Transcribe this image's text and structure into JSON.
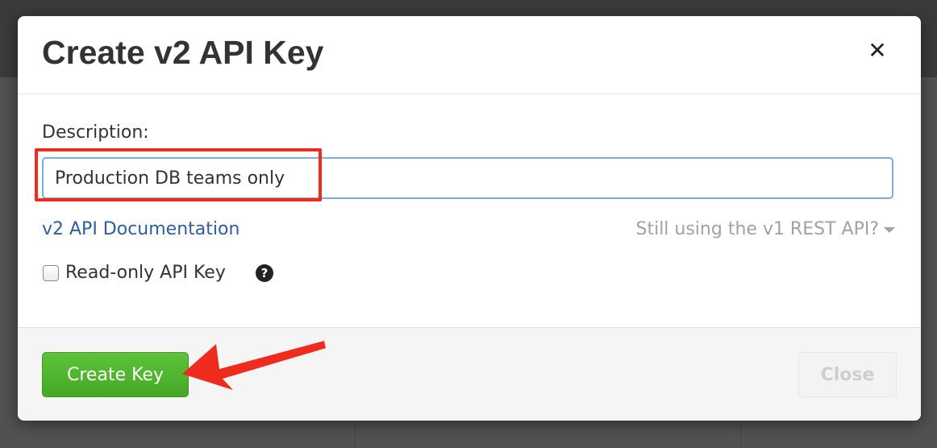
{
  "dialog": {
    "title": "Create v2 API Key",
    "close_icon": "close-icon"
  },
  "form": {
    "description_label": "Description:",
    "description_value": "Production DB teams only",
    "docs_link": "v2 API Documentation",
    "v1_toggle": "Still using the v1 REST API?",
    "readonly_label": "Read-only API Key",
    "readonly_checked": false,
    "help_icon": "question-circle-icon"
  },
  "footer": {
    "create_label": "Create Key",
    "close_label": "Close"
  },
  "annotations": {
    "highlight_color": "#ee2b1c",
    "arrow_color": "#ee2b1c"
  },
  "colors": {
    "create_button": "#4fb52f",
    "link": "#2f5d9e",
    "input_focus_border": "#7aaee0"
  }
}
